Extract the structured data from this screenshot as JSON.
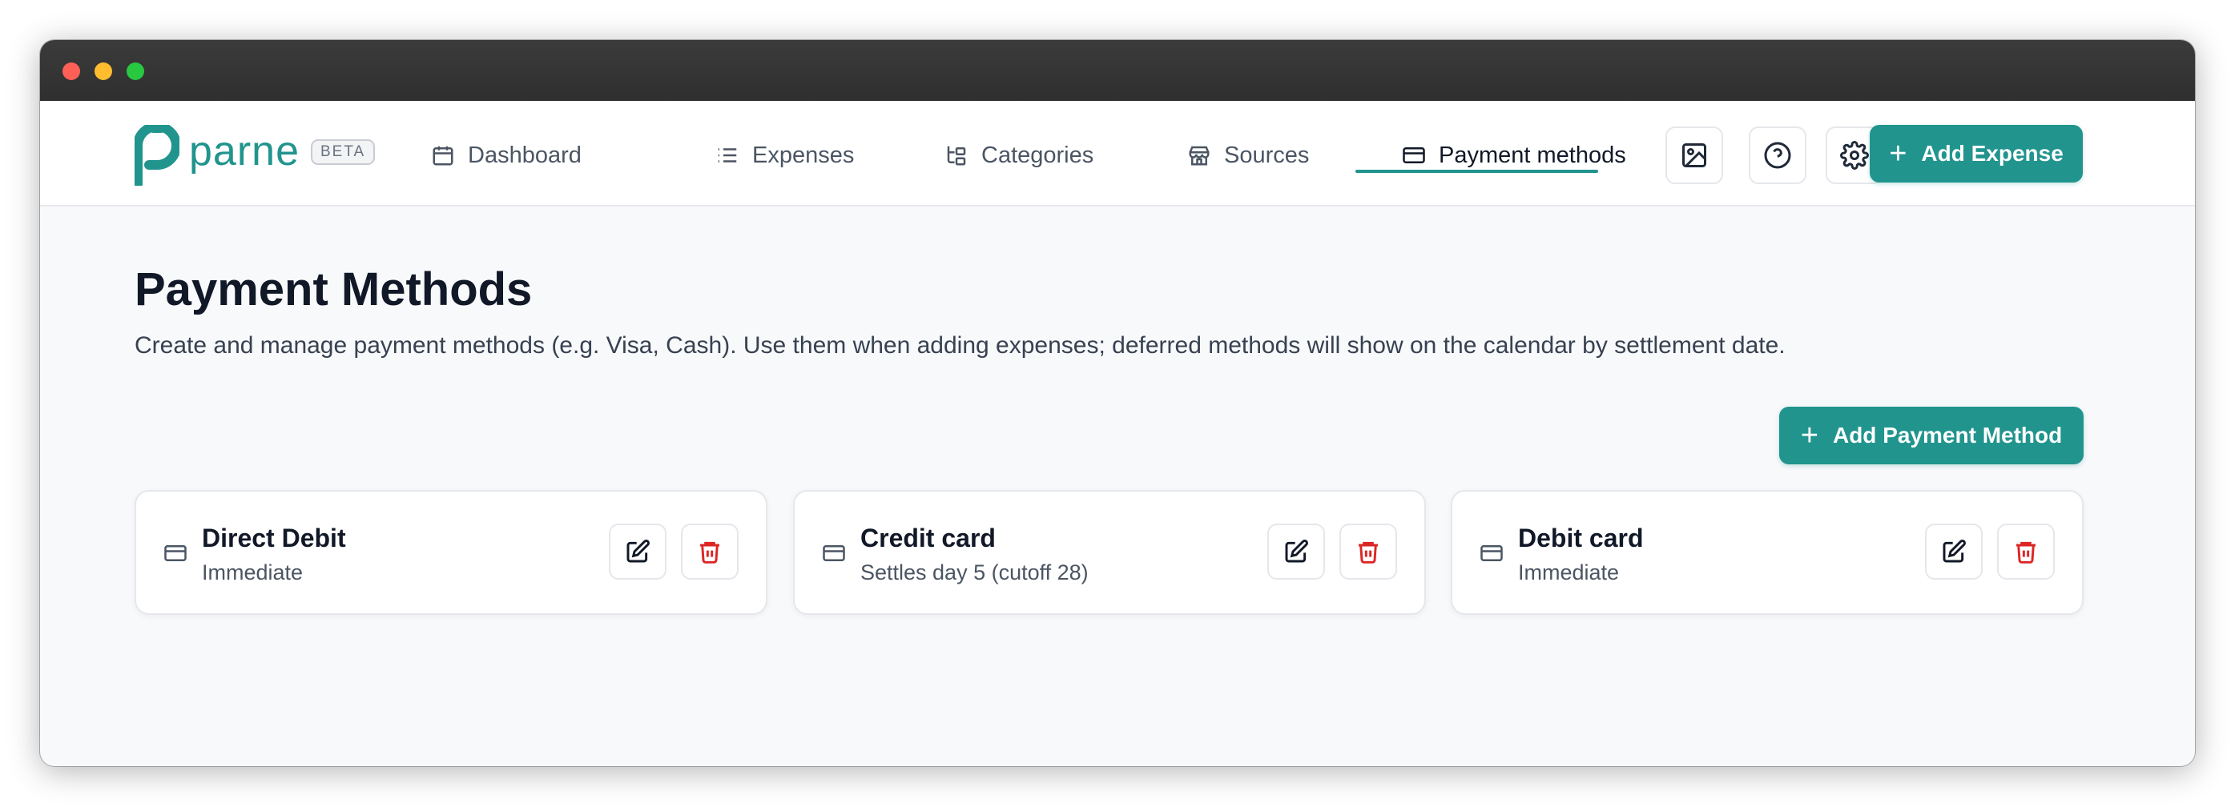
{
  "brand": {
    "name": "parne",
    "badge": "BETA",
    "accent": "#21948e"
  },
  "nav": {
    "items": [
      {
        "label": "Dashboard",
        "icon": "calendar-icon"
      },
      {
        "label": "Expenses",
        "icon": "list-icon"
      },
      {
        "label": "Categories",
        "icon": "tree-icon"
      },
      {
        "label": "Sources",
        "icon": "store-icon"
      },
      {
        "label": "Payment methods",
        "icon": "credit-card-icon",
        "active": true
      }
    ],
    "tools": [
      "image-icon",
      "help-icon",
      "gear-icon"
    ],
    "add_expense_label": "Add Expense"
  },
  "main": {
    "title": "Payment Methods",
    "description": "Create and manage payment methods (e.g. Visa, Cash). Use them when adding expenses; deferred methods will show on the calendar by settlement date.",
    "add_label": "Add Payment Method",
    "methods": [
      {
        "name": "Direct Debit",
        "detail": "Immediate"
      },
      {
        "name": "Credit card",
        "detail": "Settles day 5 (cutoff 28)"
      },
      {
        "name": "Debit card",
        "detail": "Immediate"
      }
    ]
  },
  "colors": {
    "danger": "#dc2626",
    "title_bar": "#353535"
  }
}
